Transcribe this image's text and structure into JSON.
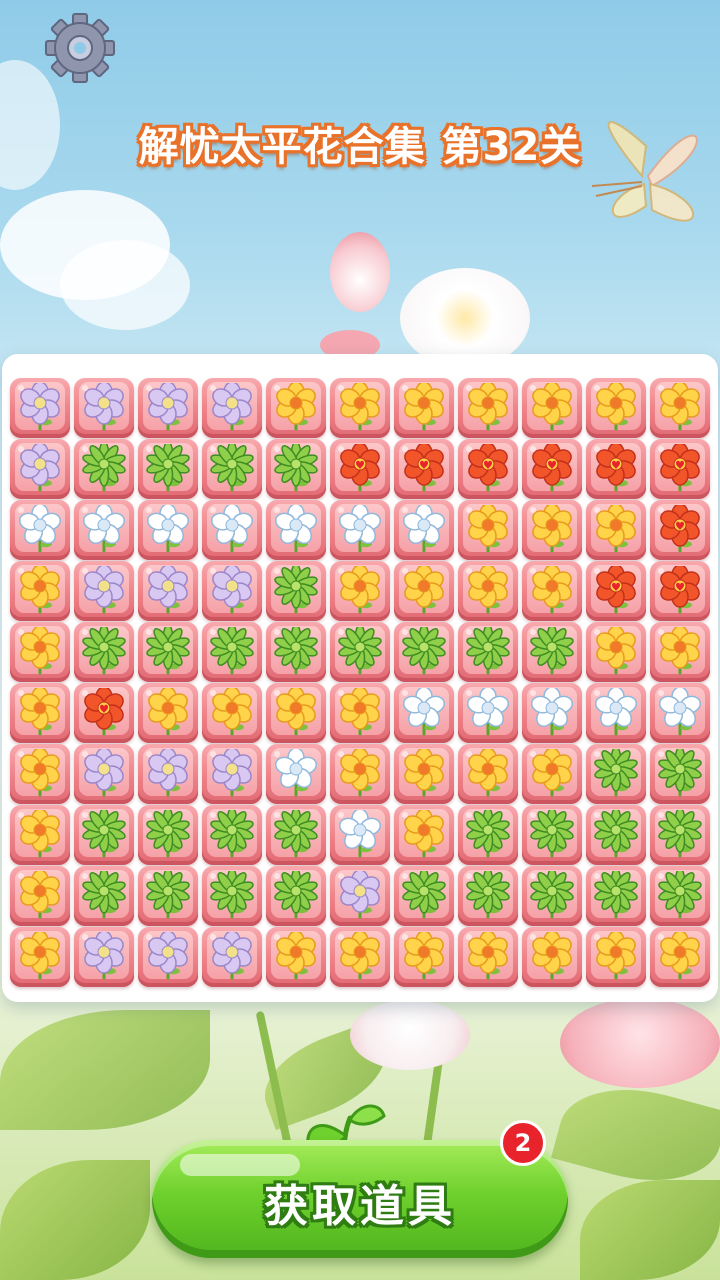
{
  "title": {
    "game_name": "解忧太平花合集",
    "level": "第32关"
  },
  "settings": {
    "icon": "gear-icon"
  },
  "board": {
    "rows": 10,
    "cols": 11,
    "tiles": [
      [
        "purple",
        "purple",
        "purple",
        "purple",
        "yellow",
        "yellow",
        "yellow",
        "yellow",
        "yellow",
        "yellow",
        "yellow"
      ],
      [
        "purple",
        "green",
        "green",
        "green",
        "green",
        "red",
        "red",
        "red",
        "red",
        "red",
        "red"
      ],
      [
        "white",
        "white",
        "white",
        "white",
        "white",
        "white",
        "white",
        "yellow",
        "yellow",
        "yellow",
        "red"
      ],
      [
        "yellow",
        "purple",
        "purple",
        "purple",
        "green",
        "yellow",
        "yellow",
        "yellow",
        "yellow",
        "red",
        "red"
      ],
      [
        "yellow",
        "green",
        "green",
        "green",
        "green",
        "green",
        "green",
        "green",
        "green",
        "yellow",
        "yellow"
      ],
      [
        "yellow",
        "red",
        "yellow",
        "yellow",
        "yellow",
        "yellow",
        "white",
        "white",
        "white",
        "white",
        "white"
      ],
      [
        "yellow",
        "purple",
        "purple",
        "purple",
        "white",
        "yellow",
        "yellow",
        "yellow",
        "yellow",
        "green",
        "green"
      ],
      [
        "yellow",
        "green",
        "green",
        "green",
        "green",
        "white",
        "yellow",
        "green",
        "green",
        "green",
        "green"
      ],
      [
        "yellow",
        "green",
        "green",
        "green",
        "green",
        "purple",
        "green",
        "green",
        "green",
        "green",
        "green"
      ],
      [
        "yellow",
        "purple",
        "purple",
        "purple",
        "yellow",
        "yellow",
        "yellow",
        "yellow",
        "yellow",
        "yellow",
        "yellow"
      ]
    ],
    "flower_colors": {
      "purple": {
        "petal": "#d9c9f2",
        "edge": "#9a86c9",
        "center": "#f3e08a"
      },
      "yellow": {
        "petal": "#ffd34a",
        "edge": "#e89a1c",
        "center": "#f07a2a"
      },
      "red": {
        "petal": "#f2552a",
        "edge": "#c2301a",
        "center": "#ffcf4a"
      },
      "white": {
        "petal": "#ffffff",
        "edge": "#8fb8dc",
        "center": "#dbe9f6"
      },
      "green": {
        "petal": "#8fcf4a",
        "edge": "#3e8c22",
        "center": "#b9e26a"
      }
    }
  },
  "actions": {
    "get_items_label": "获取道具",
    "badge_count": "2"
  }
}
